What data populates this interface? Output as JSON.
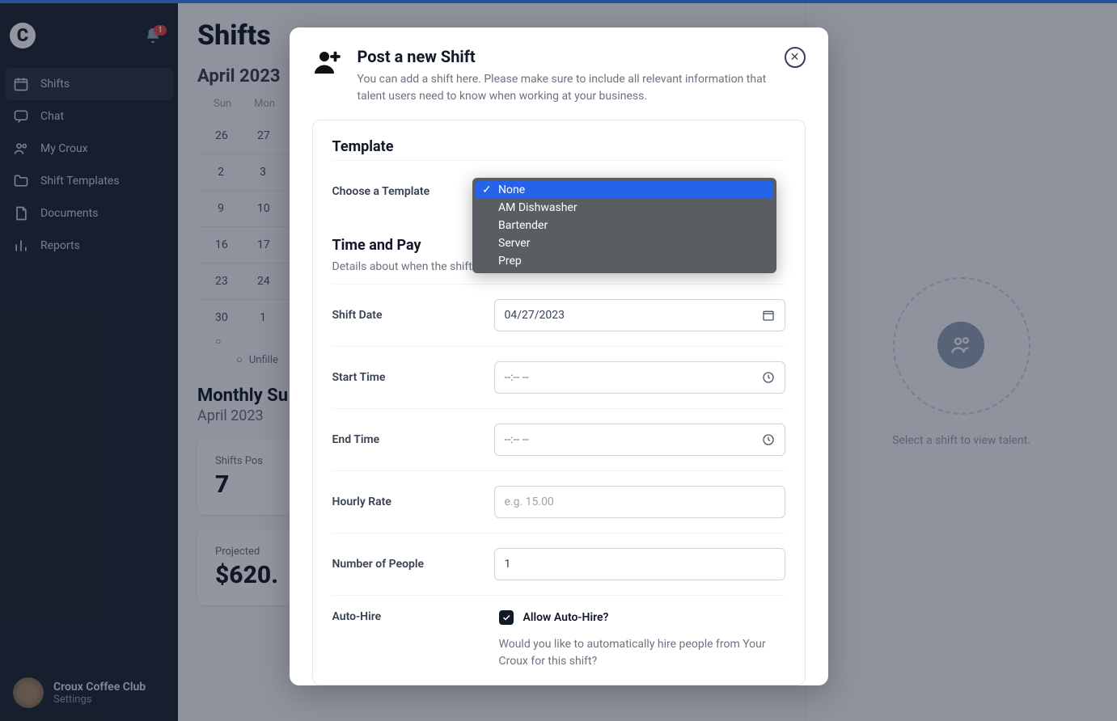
{
  "notifications": {
    "count": "1"
  },
  "sidebar": {
    "items": [
      {
        "label": "Shifts"
      },
      {
        "label": "Chat"
      },
      {
        "label": "My Croux"
      },
      {
        "label": "Shift Templates"
      },
      {
        "label": "Documents"
      },
      {
        "label": "Reports"
      }
    ],
    "footer": {
      "user": "Croux Coffee Club",
      "link": "Settings"
    }
  },
  "page": {
    "title": "Shifts",
    "month": "April 2023",
    "dayHeaders": [
      "Sun",
      "Mon"
    ],
    "rows": [
      [
        "26",
        "27"
      ],
      [
        "2",
        "3"
      ],
      [
        "9",
        "10"
      ],
      [
        "16",
        "17"
      ],
      [
        "23",
        "24"
      ],
      [
        "30",
        "1"
      ]
    ],
    "unfilledLabel": "Unfille",
    "summaryTitle": "Monthly Su",
    "summarySub": "April 2023",
    "cards": [
      {
        "label": "Shifts Pos",
        "value": "7"
      },
      {
        "label": "Projected",
        "value": "$620."
      }
    ]
  },
  "rightPanel": {
    "emptyText": "Select a shift to view talent."
  },
  "modal": {
    "title": "Post a new Shift",
    "subtitle": "You can add a shift here. Please make sure to include all relevant information that talent users need to know when working at your business.",
    "templateSection": {
      "title": "Template",
      "chooseLabel": "Choose a Template"
    },
    "dropdown": {
      "options": [
        "None",
        "AM Dishwasher",
        "Bartender",
        "Server",
        "Prep"
      ]
    },
    "timePaySection": {
      "title": "Time and Pay",
      "subtitle": "Details about when the shift                                                                                much you'll pay them."
    },
    "fields": {
      "shiftDateLabel": "Shift Date",
      "shiftDateValue": "04/27/2023",
      "startTimeLabel": "Start Time",
      "startTimeValue": "--:-- --",
      "endTimeLabel": "End Time",
      "endTimeValue": "--:-- --",
      "hourlyRateLabel": "Hourly Rate",
      "hourlyRatePlaceholder": "e.g. 15.00",
      "numPeopleLabel": "Number of People",
      "numPeopleValue": "1",
      "autoHireLabel": "Auto-Hire",
      "autoHireCheckLabel": "Allow Auto-Hire?",
      "autoHireSub": "Would you like to automatically hire people from Your Croux for this shift?"
    }
  }
}
